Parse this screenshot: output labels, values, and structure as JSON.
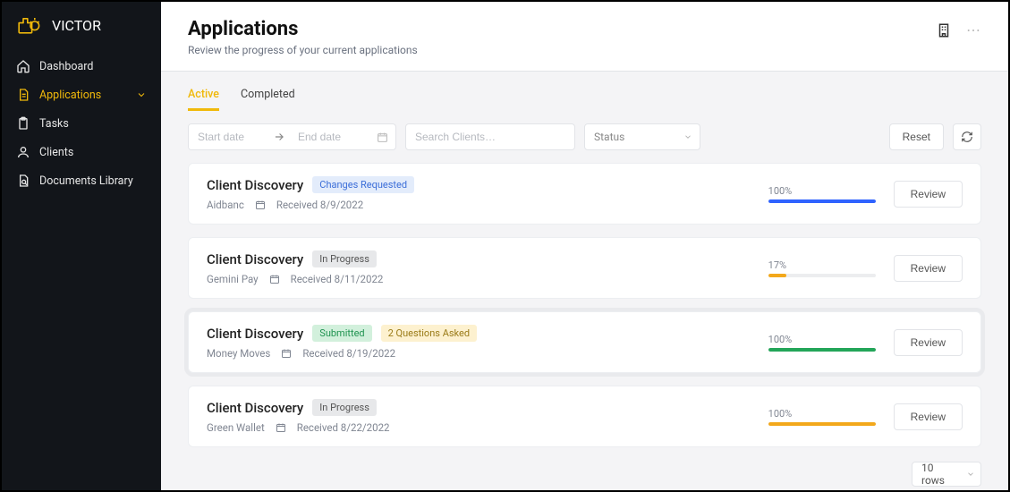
{
  "brand": {
    "name": "VICTOR"
  },
  "sidebar": {
    "items": [
      {
        "label": "Dashboard",
        "icon": "home",
        "active": false,
        "chevron": false
      },
      {
        "label": "Applications",
        "icon": "document",
        "active": true,
        "chevron": true
      },
      {
        "label": "Tasks",
        "icon": "clipboard",
        "active": false,
        "chevron": false
      },
      {
        "label": "Clients",
        "icon": "user",
        "active": false,
        "chevron": false
      },
      {
        "label": "Documents Library",
        "icon": "library",
        "active": false,
        "chevron": false
      }
    ]
  },
  "header": {
    "title": "Applications",
    "subtitle": "Review the progress of your current applications",
    "actions": {
      "building_icon": "building",
      "more": "⋯"
    }
  },
  "tabs": [
    {
      "label": "Active",
      "active": true
    },
    {
      "label": "Completed",
      "active": false
    }
  ],
  "filters": {
    "start_placeholder": "Start date",
    "end_placeholder": "End date",
    "search_placeholder": "Search Clients…",
    "status_label": "Status",
    "reset_label": "Reset"
  },
  "colors": {
    "blue": "#2f63ff",
    "orange": "#f3a81b",
    "green": "#23a559",
    "amber": "#f3a81b"
  },
  "applications": [
    {
      "title": "Client Discovery",
      "badges": [
        {
          "text": "Changes Requested",
          "cls": "badge-changes"
        }
      ],
      "client": "Aidbanc",
      "received": "Received 8/9/2022",
      "progress_pct": "100%",
      "progress_val": 100,
      "bar_color": "#2f63ff",
      "review_label": "Review",
      "highlight": false
    },
    {
      "title": "Client Discovery",
      "badges": [
        {
          "text": "In Progress",
          "cls": "badge-inprogress"
        }
      ],
      "client": "Gemini Pay",
      "received": "Received 8/11/2022",
      "progress_pct": "17%",
      "progress_val": 17,
      "bar_color": "#f3a81b",
      "review_label": "Review",
      "highlight": false
    },
    {
      "title": "Client Discovery",
      "badges": [
        {
          "text": "Submitted",
          "cls": "badge-submitted"
        },
        {
          "text": "2 Questions Asked",
          "cls": "badge-questions"
        }
      ],
      "client": "Money Moves",
      "received": "Received 8/19/2022",
      "progress_pct": "100%",
      "progress_val": 100,
      "bar_color": "#23a559",
      "review_label": "Review",
      "highlight": true
    },
    {
      "title": "Client Discovery",
      "badges": [
        {
          "text": "In Progress",
          "cls": "badge-inprogress"
        }
      ],
      "client": "Green Wallet",
      "received": "Received 8/22/2022",
      "progress_pct": "100%",
      "progress_val": 100,
      "bar_color": "#f3a81b",
      "review_label": "Review",
      "highlight": false
    }
  ],
  "pagination": {
    "rows_label": "10 rows"
  }
}
